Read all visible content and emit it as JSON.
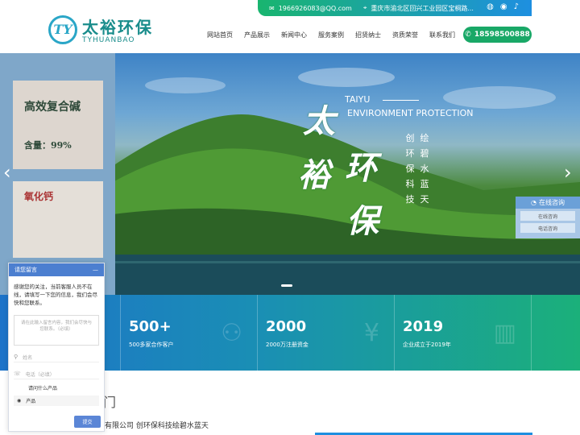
{
  "topbar": {
    "email": "1966926083@QQ.com",
    "address": "重庆市渝北区回兴工业园区宝桐路..."
  },
  "logo": {
    "mark": "TY",
    "cn": "太裕环保",
    "en": "TYHUANBAO"
  },
  "nav": [
    "网站首页",
    "产品展示",
    "新闻中心",
    "服务案例",
    "招贤纳士",
    "资质荣誉",
    "联系我们"
  ],
  "phone": "18598500888",
  "products": [
    "高效复合碱",
    "含量：99%",
    "氧化钙",
    "",
    ""
  ],
  "hero": {
    "en1": "TAIYU",
    "en2": "ENVIRONMENT PROTECTION",
    "big": [
      "太",
      "裕",
      "环",
      "保"
    ],
    "col1": [
      "创",
      "环",
      "保",
      "科",
      "技"
    ],
    "col2": [
      "绘",
      "碧",
      "水",
      "蓝",
      "天"
    ]
  },
  "consult": {
    "title": "在线咨询",
    "btn1": "在线咨询",
    "btn2": "电话咨询"
  },
  "stats": [
    {
      "number": "500+",
      "desc": "500多家合作客户",
      "icon": "handshake-icon"
    },
    {
      "number": "2000",
      "desc": "2000万注册资金",
      "icon": "money-icon"
    },
    {
      "number": "2019",
      "desc": "企业成立于2019年",
      "icon": "building-icon"
    }
  ],
  "bottom": {
    "title": "门",
    "subtitle": "有限公司 创环保科技绘碧水蓝天"
  },
  "chat": {
    "title": "请您留言",
    "close": "—",
    "message": "感谢您的关注，当前客服人员不在线，请填写一下您的信息，我们会尽快和您联系。",
    "textarea_placeholder": "请在此输入留言内容，我们会尽快与您联系。（必填）",
    "name_placeholder": "姓名",
    "phone_placeholder": "电话（必填）",
    "product_question": "请问什么产品",
    "product_value": "产品",
    "submit": "提交"
  },
  "colors": {
    "brand_green": "#19a867",
    "brand_blue": "#1e8fe0",
    "teal": "#1a8d8c"
  }
}
